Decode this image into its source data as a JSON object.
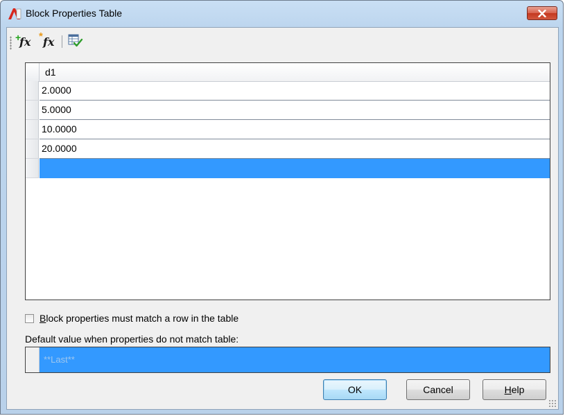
{
  "window": {
    "title": "Block Properties Table"
  },
  "toolbar": {
    "items": [
      {
        "name": "new-property-parameter-button",
        "icon": "fx-plus-icon"
      },
      {
        "name": "add-user-parameter-button",
        "icon": "fx-star-icon"
      },
      {
        "name": "audit-button",
        "icon": "table-check-icon"
      }
    ]
  },
  "table": {
    "columns": [
      "d1"
    ],
    "rows": [
      "2.0000",
      "5.0000",
      "10.0000",
      "20.0000",
      ""
    ],
    "selected_row_index": 4
  },
  "options": {
    "match_row_label_accesskey": "B",
    "match_row_label_rest": "lock properties must match a row in the table",
    "match_row_checked": false,
    "default_value_label": "Default value when properties do not match table:",
    "default_value": "**Last**"
  },
  "buttons": {
    "ok": "OK",
    "cancel": "Cancel",
    "help_accesskey": "H",
    "help_rest": "elp"
  },
  "colors": {
    "selection": "#3399ff",
    "close_button": "#c4381f"
  }
}
